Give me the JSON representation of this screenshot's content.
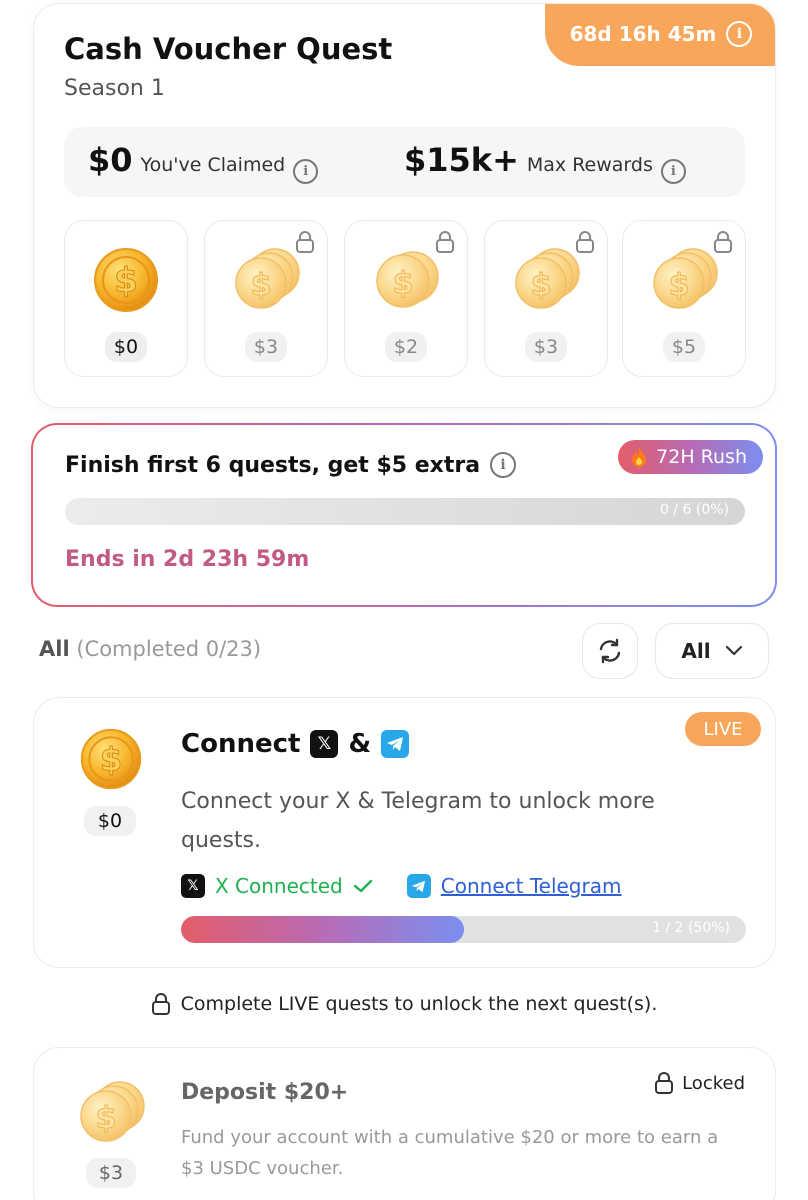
{
  "header": {
    "timer": "68d 16h 45m",
    "title": "Cash Voucher Quest",
    "subtitle": "Season 1",
    "claimed_value": "$0",
    "claimed_label": "You've Claimed",
    "max_value": "$15k+",
    "max_label": "Max Rewards"
  },
  "vouchers": [
    {
      "amount": "$0",
      "locked": false
    },
    {
      "amount": "$3",
      "locked": true
    },
    {
      "amount": "$2",
      "locked": true
    },
    {
      "amount": "$3",
      "locked": true
    },
    {
      "amount": "$5",
      "locked": true
    }
  ],
  "rush": {
    "title": "Finish first 6 quests, get $5 extra",
    "badge": "72H Rush",
    "progress_text": "0 / 6  (0%)",
    "progress_fraction": 0,
    "ends": "Ends in 2d 23h 59m"
  },
  "filter": {
    "label": "All",
    "completed": "(Completed 0/23)",
    "dropdown": "All"
  },
  "quest1": {
    "badge": "LIVE",
    "amount": "$0",
    "title_prefix": "Connect",
    "title_amp": "&",
    "description": "Connect your X & Telegram to unlock more quests.",
    "x_status": "X Connected",
    "tg_link": "Connect Telegram",
    "progress_text": "1 / 2  (50%)",
    "progress_fraction": 0.5
  },
  "unlock_note": "Complete LIVE quests to unlock the next quest(s).",
  "quest2": {
    "amount": "$3",
    "title": "Deposit $20+",
    "status": "Locked",
    "description": "Fund your account with a cumulative $20 or more to earn a $3 USDC voucher."
  },
  "colors": {
    "accent_orange": "#f7a65a",
    "gradient_start": "#e35d6a",
    "gradient_mid": "#b86bb5",
    "gradient_end": "#7b8ff0",
    "connected_green": "#1fb14f",
    "link_blue": "#2f5fd4"
  }
}
